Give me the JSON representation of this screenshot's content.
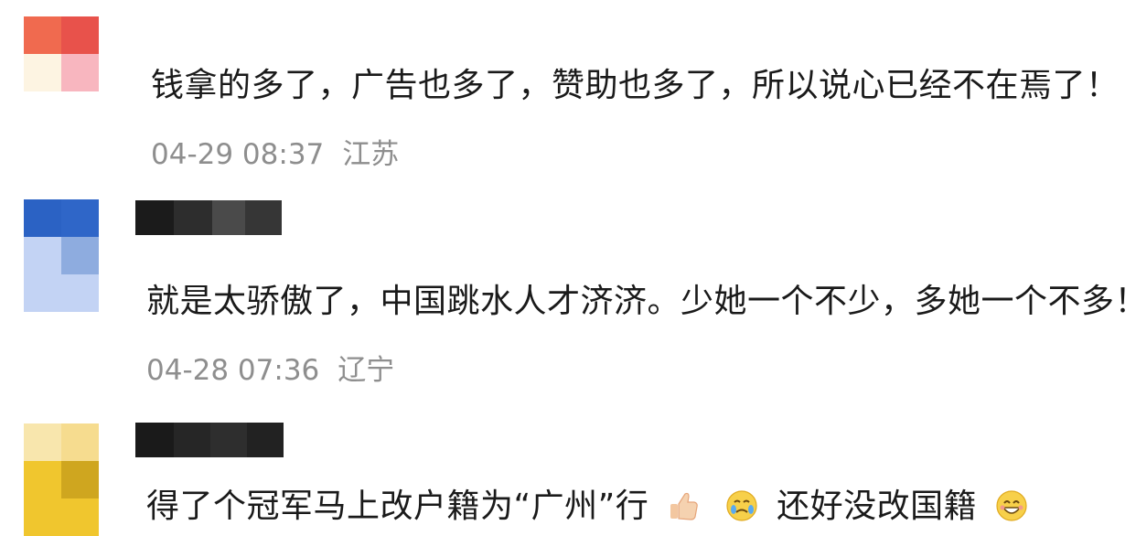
{
  "comments": [
    {
      "text": "钱拿的多了，广告也多了，赞助也多了，所以说心已经不在焉了！",
      "time": "04-29 08:37",
      "location": "江苏",
      "avatar_colors": [
        "#f06a4f",
        "#e8524b",
        "#fdf4e2",
        "#f8b6bf"
      ]
    },
    {
      "text": "就是太骄傲了，中国跳水人才济济。少她一个不少，多她一个不多！",
      "time": "04-28 07:36",
      "location": "辽宁",
      "avatar_colors": [
        "#2b62c4",
        "#2f66c8",
        "#c3d3f4",
        "#8eacdf"
      ]
    },
    {
      "text_a": "得了个冠军马上改户籍为“广州”行",
      "text_b": "还好没改国籍",
      "emojis": [
        "thumbs-up",
        "crying-face",
        "smiling-face"
      ],
      "avatar_colors": [
        "#f8e6ad",
        "#f6dc8f",
        "#f0c62e",
        "#cfa61f"
      ]
    }
  ],
  "colors": {
    "text": "#1a1a1a",
    "meta": "#8e8e8e",
    "name_redaction": [
      "#1b1b1b",
      "#3a3a3a",
      "#2a2a2a"
    ]
  }
}
